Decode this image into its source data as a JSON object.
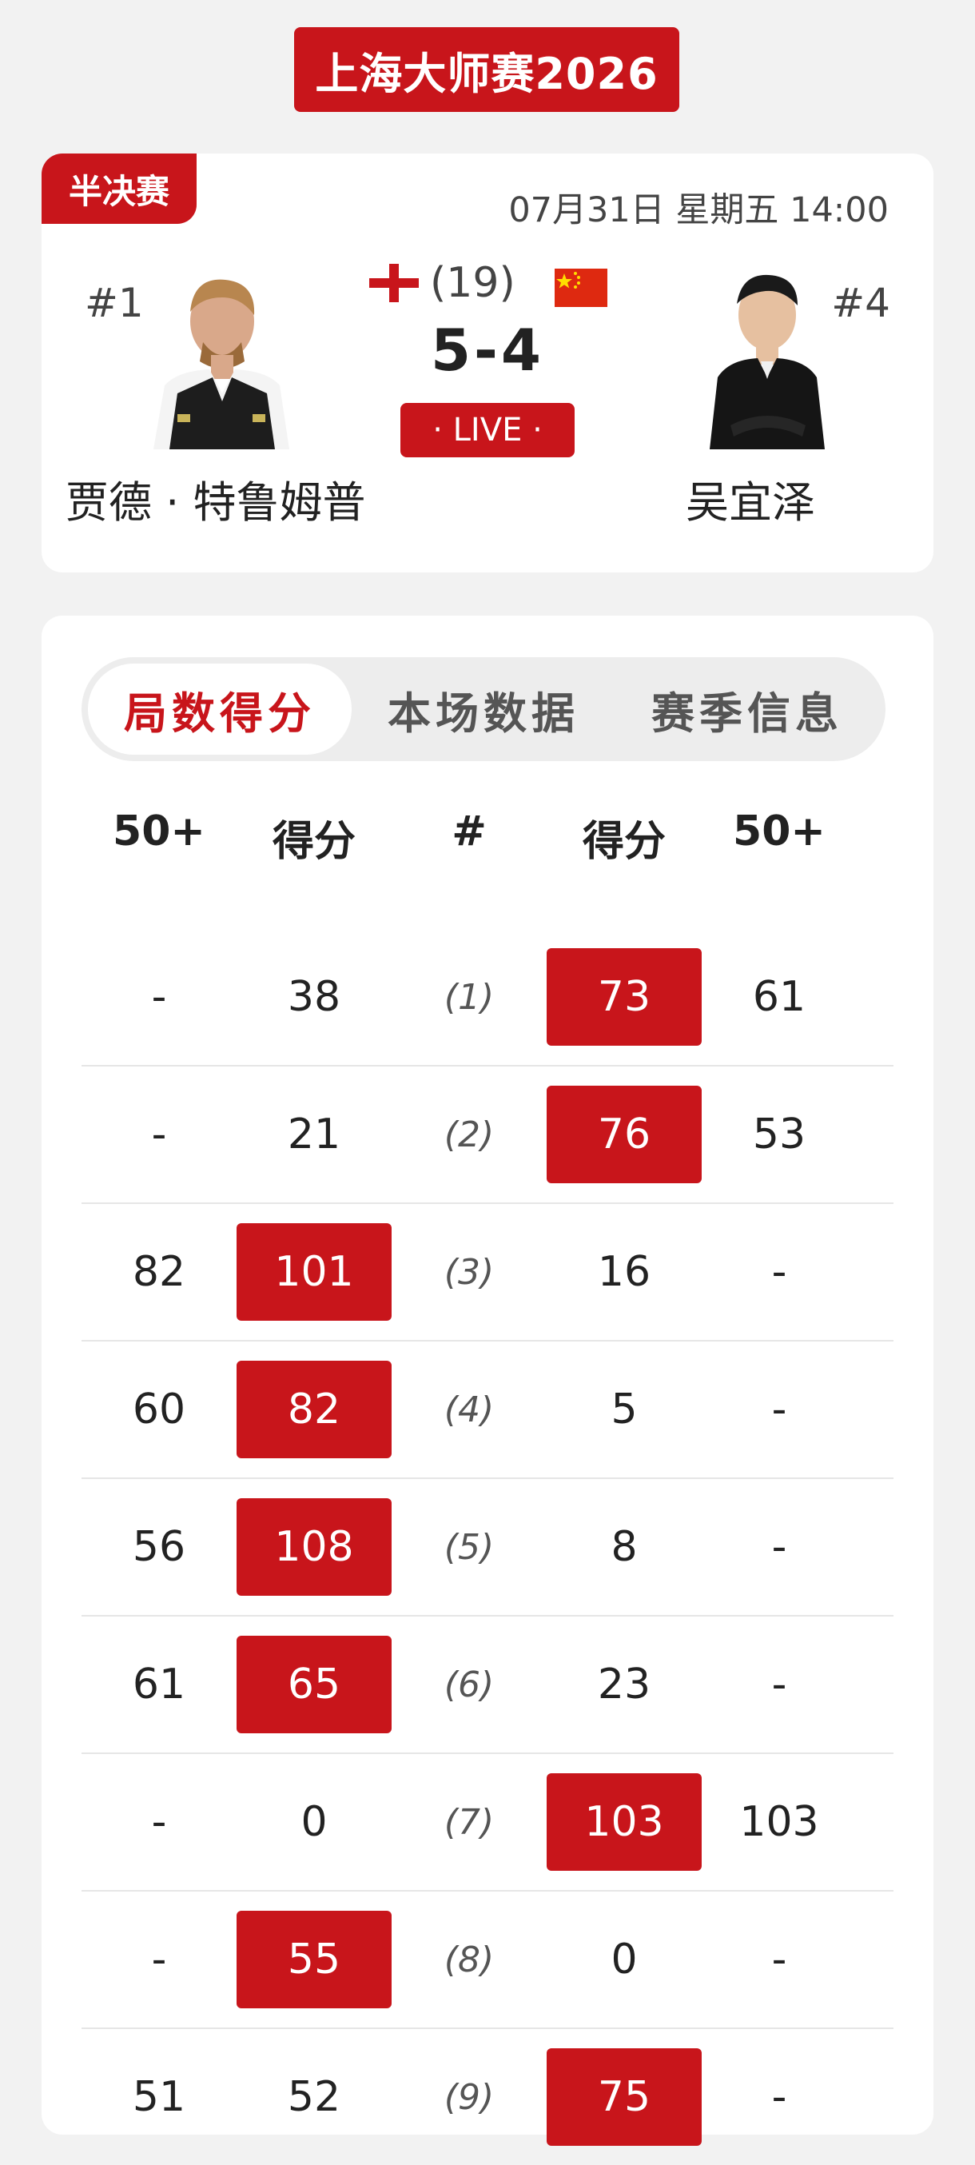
{
  "tournament_title": "上海大师赛2026",
  "match": {
    "round": "半决赛",
    "datetime": "07月31日 星期五 14:00",
    "best_of": "(19)",
    "score": "5-4",
    "status": "· LIVE ·",
    "player1": {
      "rank": "#1",
      "name": "贾德 · 特鲁姆普",
      "flag": "england-flag-icon"
    },
    "player2": {
      "rank": "#4",
      "name": "吴宜泽",
      "flag": "china-flag-icon"
    }
  },
  "tabs": [
    {
      "label": "局数得分",
      "active": true
    },
    {
      "label": "本场数据",
      "active": false
    },
    {
      "label": "赛季信息",
      "active": false
    }
  ],
  "columns": [
    "50+",
    "得分",
    "#",
    "得分",
    "50+"
  ],
  "frames": [
    {
      "p1_break": "-",
      "p1_score": "38",
      "frame": "(1)",
      "p2_score": "73",
      "p2_break": "61",
      "winner": 2
    },
    {
      "p1_break": "-",
      "p1_score": "21",
      "frame": "(2)",
      "p2_score": "76",
      "p2_break": "53",
      "winner": 2
    },
    {
      "p1_break": "82",
      "p1_score": "101",
      "frame": "(3)",
      "p2_score": "16",
      "p2_break": "-",
      "winner": 1
    },
    {
      "p1_break": "60",
      "p1_score": "82",
      "frame": "(4)",
      "p2_score": "5",
      "p2_break": "-",
      "winner": 1
    },
    {
      "p1_break": "56",
      "p1_score": "108",
      "frame": "(5)",
      "p2_score": "8",
      "p2_break": "-",
      "winner": 1
    },
    {
      "p1_break": "61",
      "p1_score": "65",
      "frame": "(6)",
      "p2_score": "23",
      "p2_break": "-",
      "winner": 1
    },
    {
      "p1_break": "-",
      "p1_score": "0",
      "frame": "(7)",
      "p2_score": "103",
      "p2_break": "103",
      "winner": 2
    },
    {
      "p1_break": "-",
      "p1_score": "55",
      "frame": "(8)",
      "p2_score": "0",
      "p2_break": "-",
      "winner": 1
    },
    {
      "p1_break": "51",
      "p1_score": "52",
      "frame": "(9)",
      "p2_score": "75",
      "p2_break": "-",
      "winner": 2
    }
  ],
  "colors": {
    "accent": "#c8151b",
    "background": "#f2f2f2",
    "card": "#ffffff"
  }
}
